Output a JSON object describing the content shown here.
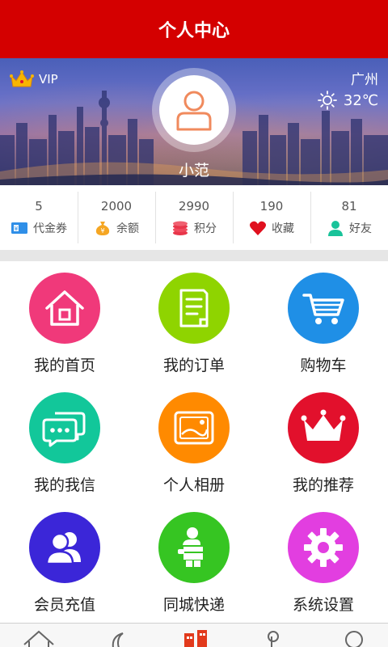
{
  "header": {
    "title": "个人中心"
  },
  "profile": {
    "vip_label": "VIP",
    "city": "广州",
    "temperature": "32℃",
    "username": "小范"
  },
  "stats": [
    {
      "value": "5",
      "label": "代金券",
      "icon": "ticket-icon"
    },
    {
      "value": "2000",
      "label": "余额",
      "icon": "money-bag-icon"
    },
    {
      "value": "2990",
      "label": "积分",
      "icon": "coins-icon"
    },
    {
      "value": "190",
      "label": "收藏",
      "icon": "heart-icon"
    },
    {
      "value": "81",
      "label": "好友",
      "icon": "friend-icon"
    }
  ],
  "menu": [
    {
      "label": "我的首页",
      "icon": "home-icon",
      "color": "#f0397a"
    },
    {
      "label": "我的订单",
      "icon": "order-icon",
      "color": "#8fd400"
    },
    {
      "label": "购物车",
      "icon": "cart-icon",
      "color": "#1f8fe6"
    },
    {
      "label": "我的我信",
      "icon": "message-icon",
      "color": "#12c79a"
    },
    {
      "label": "个人相册",
      "icon": "album-icon",
      "color": "#ff8a00"
    },
    {
      "label": "我的推荐",
      "icon": "crown-icon",
      "color": "#e2102c"
    },
    {
      "label": "会员充值",
      "icon": "members-icon",
      "color": "#3b26d8"
    },
    {
      "label": "同城快递",
      "icon": "courier-icon",
      "color": "#36c522"
    },
    {
      "label": "系统设置",
      "icon": "gear-icon",
      "color": "#e23ee0"
    }
  ],
  "tabbar": [
    {
      "icon": "home-tab-icon"
    },
    {
      "icon": "moon-tab-icon"
    },
    {
      "icon": "building-tab-icon",
      "active_color": "#e23a1c"
    },
    {
      "icon": "touch-tab-icon"
    },
    {
      "icon": "search-tab-icon"
    }
  ]
}
